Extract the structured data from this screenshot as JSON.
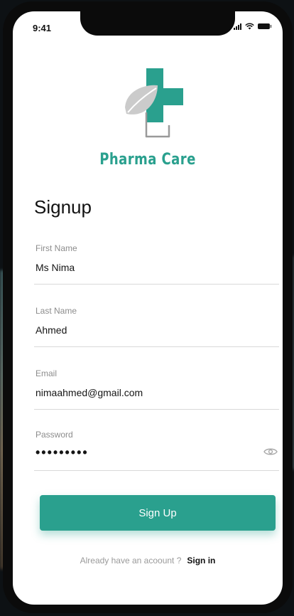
{
  "status_bar": {
    "time": "9:41"
  },
  "brand": {
    "name": "Pharma Care",
    "colors": {
      "primary": "#2aa08e",
      "leaf": "#c9c9c9",
      "outline": "#9a9a9a"
    }
  },
  "page": {
    "title": "Signup"
  },
  "form": {
    "first_name": {
      "label": "First Name",
      "value": "Ms Nima"
    },
    "last_name": {
      "label": "Last Name",
      "value": "Ahmed"
    },
    "email": {
      "label": "Email",
      "value": "nimaahmed@gmail.com"
    },
    "password": {
      "label": "Password",
      "masked_value": "•••••••••",
      "toggle_icon": "eye-icon"
    }
  },
  "actions": {
    "signup_label": "Sign Up"
  },
  "footer": {
    "prompt": "Already have an acoount ?",
    "signin_label": "Sign in"
  }
}
